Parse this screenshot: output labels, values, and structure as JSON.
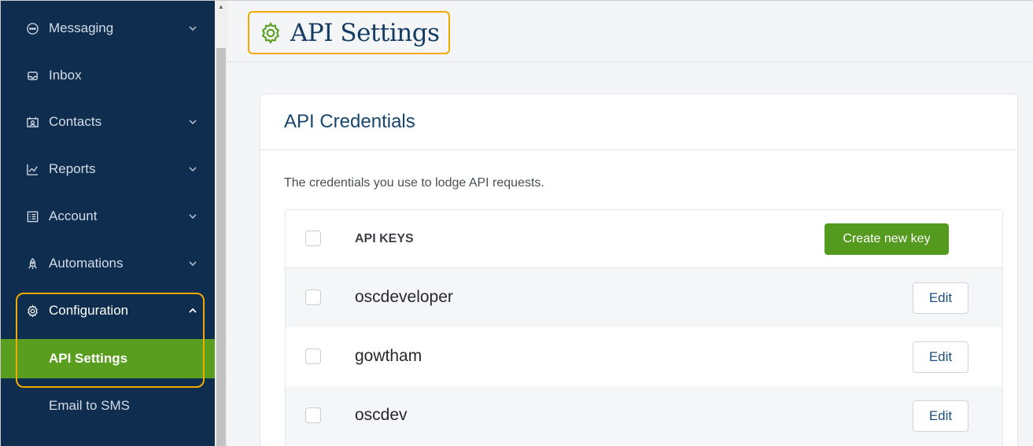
{
  "sidebar": {
    "items": [
      {
        "label": "Messaging",
        "icon": "chat-bubble-icon",
        "expandable": true
      },
      {
        "label": "Inbox",
        "icon": "inbox-icon",
        "expandable": false
      },
      {
        "label": "Contacts",
        "icon": "contact-card-icon",
        "expandable": true
      },
      {
        "label": "Reports",
        "icon": "line-chart-icon",
        "expandable": true
      },
      {
        "label": "Account",
        "icon": "account-list-icon",
        "expandable": true
      },
      {
        "label": "Automations",
        "icon": "rocket-icon",
        "expandable": true
      },
      {
        "label": "Configuration",
        "icon": "gear-icon",
        "expandable": true,
        "expanded": true
      }
    ],
    "sub_items": [
      {
        "label": "API Settings",
        "active": true
      },
      {
        "label": "Email to SMS",
        "active": false
      }
    ]
  },
  "header": {
    "title": "API Settings",
    "icon": "gear-icon"
  },
  "card": {
    "title": "API Credentials",
    "description": "The credentials you use to lodge API requests.",
    "table": {
      "column_header": "API KEYS",
      "create_button": "Create new key",
      "rows": [
        {
          "name": "oscdeveloper",
          "action": "Edit"
        },
        {
          "name": "gowtham",
          "action": "Edit"
        },
        {
          "name": "oscdev",
          "action": "Edit"
        }
      ]
    }
  },
  "colors": {
    "sidebar_bg": "#0f2d4e",
    "active_bg": "#5a9e1f",
    "highlight": "#f2a900",
    "title_color": "#153d63",
    "primary_button": "#549a1e"
  }
}
